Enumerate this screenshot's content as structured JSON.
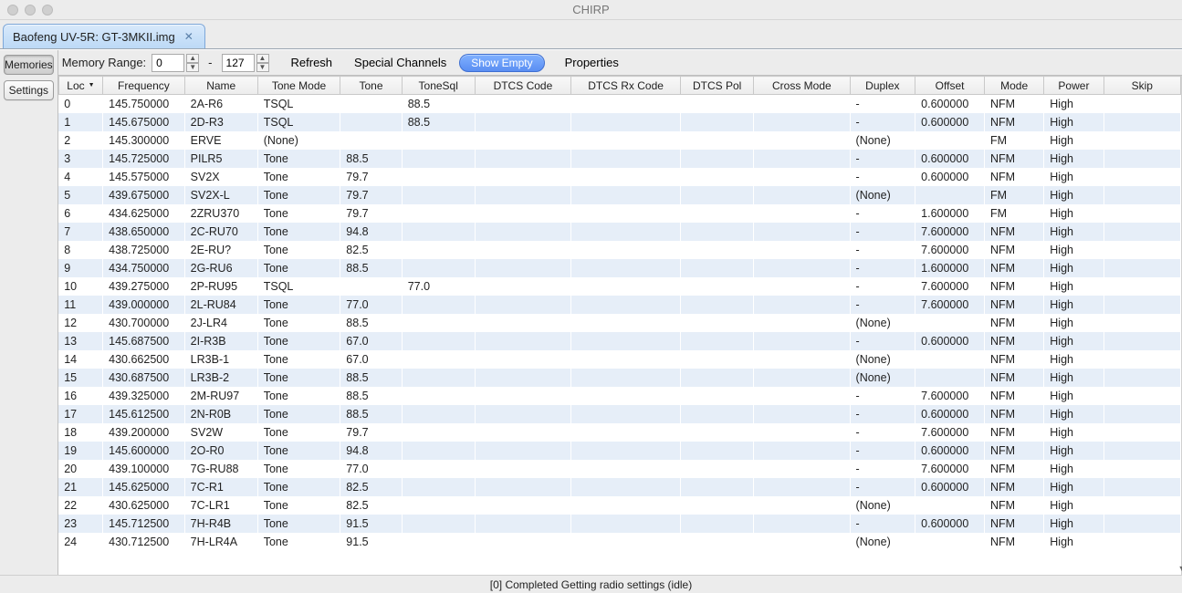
{
  "app_title": "CHIRP",
  "tab": {
    "label": "Baofeng UV-5R: GT-3MKII.img"
  },
  "sidebar": {
    "memories": "Memories",
    "settings": "Settings"
  },
  "toolbar": {
    "range_label": "Memory Range:",
    "from": "0",
    "dash": "-",
    "to": "127",
    "refresh": "Refresh",
    "special": "Special Channels",
    "show_empty": "Show Empty",
    "properties": "Properties"
  },
  "columns": [
    "Loc",
    "Frequency",
    "Name",
    "Tone Mode",
    "Tone",
    "ToneSql",
    "DTCS Code",
    "DTCS Rx Code",
    "DTCS Pol",
    "Cross Mode",
    "Duplex",
    "Offset",
    "Mode",
    "Power",
    "Skip"
  ],
  "rows": [
    {
      "loc": "0",
      "freq": "145.750000",
      "name": "2A-R6",
      "tonemode": "TSQL",
      "tone": "",
      "tonesql": "88.5",
      "dtcs": "",
      "dtcsrx": "",
      "dtcspol": "",
      "cross": "",
      "duplex": "-",
      "offset": "0.600000",
      "mode": "NFM",
      "power": "High",
      "skip": ""
    },
    {
      "loc": "1",
      "freq": "145.675000",
      "name": "2D-R3",
      "tonemode": "TSQL",
      "tone": "",
      "tonesql": "88.5",
      "dtcs": "",
      "dtcsrx": "",
      "dtcspol": "",
      "cross": "",
      "duplex": "-",
      "offset": "0.600000",
      "mode": "NFM",
      "power": "High",
      "skip": ""
    },
    {
      "loc": "2",
      "freq": "145.300000",
      "name": "ERVE",
      "tonemode": "(None)",
      "tone": "",
      "tonesql": "",
      "dtcs": "",
      "dtcsrx": "",
      "dtcspol": "",
      "cross": "",
      "duplex": "(None)",
      "offset": "",
      "mode": "FM",
      "power": "High",
      "skip": ""
    },
    {
      "loc": "3",
      "freq": "145.725000",
      "name": "PILR5",
      "tonemode": "Tone",
      "tone": "88.5",
      "tonesql": "",
      "dtcs": "",
      "dtcsrx": "",
      "dtcspol": "",
      "cross": "",
      "duplex": "-",
      "offset": "0.600000",
      "mode": "NFM",
      "power": "High",
      "skip": ""
    },
    {
      "loc": "4",
      "freq": "145.575000",
      "name": "SV2X",
      "tonemode": "Tone",
      "tone": "79.7",
      "tonesql": "",
      "dtcs": "",
      "dtcsrx": "",
      "dtcspol": "",
      "cross": "",
      "duplex": "-",
      "offset": "0.600000",
      "mode": "NFM",
      "power": "High",
      "skip": ""
    },
    {
      "loc": "5",
      "freq": "439.675000",
      "name": "SV2X-L",
      "tonemode": "Tone",
      "tone": "79.7",
      "tonesql": "",
      "dtcs": "",
      "dtcsrx": "",
      "dtcspol": "",
      "cross": "",
      "duplex": "(None)",
      "offset": "",
      "mode": "FM",
      "power": "High",
      "skip": ""
    },
    {
      "loc": "6",
      "freq": "434.625000",
      "name": "2ZRU370",
      "tonemode": "Tone",
      "tone": "79.7",
      "tonesql": "",
      "dtcs": "",
      "dtcsrx": "",
      "dtcspol": "",
      "cross": "",
      "duplex": "-",
      "offset": "1.600000",
      "mode": "FM",
      "power": "High",
      "skip": ""
    },
    {
      "loc": "7",
      "freq": "438.650000",
      "name": "2C-RU70",
      "tonemode": "Tone",
      "tone": "94.8",
      "tonesql": "",
      "dtcs": "",
      "dtcsrx": "",
      "dtcspol": "",
      "cross": "",
      "duplex": "-",
      "offset": "7.600000",
      "mode": "NFM",
      "power": "High",
      "skip": ""
    },
    {
      "loc": "8",
      "freq": "438.725000",
      "name": "2E-RU?",
      "tonemode": "Tone",
      "tone": "82.5",
      "tonesql": "",
      "dtcs": "",
      "dtcsrx": "",
      "dtcspol": "",
      "cross": "",
      "duplex": "-",
      "offset": "7.600000",
      "mode": "NFM",
      "power": "High",
      "skip": ""
    },
    {
      "loc": "9",
      "freq": "434.750000",
      "name": "2G-RU6",
      "tonemode": "Tone",
      "tone": "88.5",
      "tonesql": "",
      "dtcs": "",
      "dtcsrx": "",
      "dtcspol": "",
      "cross": "",
      "duplex": "-",
      "offset": "1.600000",
      "mode": "NFM",
      "power": "High",
      "skip": ""
    },
    {
      "loc": "10",
      "freq": "439.275000",
      "name": "2P-RU95",
      "tonemode": "TSQL",
      "tone": "",
      "tonesql": "77.0",
      "dtcs": "",
      "dtcsrx": "",
      "dtcspol": "",
      "cross": "",
      "duplex": "-",
      "offset": "7.600000",
      "mode": "NFM",
      "power": "High",
      "skip": ""
    },
    {
      "loc": "11",
      "freq": "439.000000",
      "name": "2L-RU84",
      "tonemode": "Tone",
      "tone": "77.0",
      "tonesql": "",
      "dtcs": "",
      "dtcsrx": "",
      "dtcspol": "",
      "cross": "",
      "duplex": "-",
      "offset": "7.600000",
      "mode": "NFM",
      "power": "High",
      "skip": ""
    },
    {
      "loc": "12",
      "freq": "430.700000",
      "name": "2J-LR4",
      "tonemode": "Tone",
      "tone": "88.5",
      "tonesql": "",
      "dtcs": "",
      "dtcsrx": "",
      "dtcspol": "",
      "cross": "",
      "duplex": "(None)",
      "offset": "",
      "mode": "NFM",
      "power": "High",
      "skip": ""
    },
    {
      "loc": "13",
      "freq": "145.687500",
      "name": "2I-R3B",
      "tonemode": "Tone",
      "tone": "67.0",
      "tonesql": "",
      "dtcs": "",
      "dtcsrx": "",
      "dtcspol": "",
      "cross": "",
      "duplex": "-",
      "offset": "0.600000",
      "mode": "NFM",
      "power": "High",
      "skip": ""
    },
    {
      "loc": "14",
      "freq": "430.662500",
      "name": "LR3B-1",
      "tonemode": "Tone",
      "tone": "67.0",
      "tonesql": "",
      "dtcs": "",
      "dtcsrx": "",
      "dtcspol": "",
      "cross": "",
      "duplex": "(None)",
      "offset": "",
      "mode": "NFM",
      "power": "High",
      "skip": ""
    },
    {
      "loc": "15",
      "freq": "430.687500",
      "name": "LR3B-2",
      "tonemode": "Tone",
      "tone": "88.5",
      "tonesql": "",
      "dtcs": "",
      "dtcsrx": "",
      "dtcspol": "",
      "cross": "",
      "duplex": "(None)",
      "offset": "",
      "mode": "NFM",
      "power": "High",
      "skip": ""
    },
    {
      "loc": "16",
      "freq": "439.325000",
      "name": "2M-RU97",
      "tonemode": "Tone",
      "tone": "88.5",
      "tonesql": "",
      "dtcs": "",
      "dtcsrx": "",
      "dtcspol": "",
      "cross": "",
      "duplex": "-",
      "offset": "7.600000",
      "mode": "NFM",
      "power": "High",
      "skip": ""
    },
    {
      "loc": "17",
      "freq": "145.612500",
      "name": "2N-R0B",
      "tonemode": "Tone",
      "tone": "88.5",
      "tonesql": "",
      "dtcs": "",
      "dtcsrx": "",
      "dtcspol": "",
      "cross": "",
      "duplex": "-",
      "offset": "0.600000",
      "mode": "NFM",
      "power": "High",
      "skip": ""
    },
    {
      "loc": "18",
      "freq": "439.200000",
      "name": "SV2W",
      "tonemode": "Tone",
      "tone": "79.7",
      "tonesql": "",
      "dtcs": "",
      "dtcsrx": "",
      "dtcspol": "",
      "cross": "",
      "duplex": "-",
      "offset": "7.600000",
      "mode": "NFM",
      "power": "High",
      "skip": ""
    },
    {
      "loc": "19",
      "freq": "145.600000",
      "name": "2O-R0",
      "tonemode": "Tone",
      "tone": "94.8",
      "tonesql": "",
      "dtcs": "",
      "dtcsrx": "",
      "dtcspol": "",
      "cross": "",
      "duplex": "-",
      "offset": "0.600000",
      "mode": "NFM",
      "power": "High",
      "skip": ""
    },
    {
      "loc": "20",
      "freq": "439.100000",
      "name": "7G-RU88",
      "tonemode": "Tone",
      "tone": "77.0",
      "tonesql": "",
      "dtcs": "",
      "dtcsrx": "",
      "dtcspol": "",
      "cross": "",
      "duplex": "-",
      "offset": "7.600000",
      "mode": "NFM",
      "power": "High",
      "skip": ""
    },
    {
      "loc": "21",
      "freq": "145.625000",
      "name": "7C-R1",
      "tonemode": "Tone",
      "tone": "82.5",
      "tonesql": "",
      "dtcs": "",
      "dtcsrx": "",
      "dtcspol": "",
      "cross": "",
      "duplex": "-",
      "offset": "0.600000",
      "mode": "NFM",
      "power": "High",
      "skip": ""
    },
    {
      "loc": "22",
      "freq": "430.625000",
      "name": "7C-LR1",
      "tonemode": "Tone",
      "tone": "82.5",
      "tonesql": "",
      "dtcs": "",
      "dtcsrx": "",
      "dtcspol": "",
      "cross": "",
      "duplex": "(None)",
      "offset": "",
      "mode": "NFM",
      "power": "High",
      "skip": ""
    },
    {
      "loc": "23",
      "freq": "145.712500",
      "name": "7H-R4B",
      "tonemode": "Tone",
      "tone": "91.5",
      "tonesql": "",
      "dtcs": "",
      "dtcsrx": "",
      "dtcspol": "",
      "cross": "",
      "duplex": "-",
      "offset": "0.600000",
      "mode": "NFM",
      "power": "High",
      "skip": ""
    },
    {
      "loc": "24",
      "freq": "430.712500",
      "name": "7H-LR4A",
      "tonemode": "Tone",
      "tone": "91.5",
      "tonesql": "",
      "dtcs": "",
      "dtcsrx": "",
      "dtcspol": "",
      "cross": "",
      "duplex": "(None)",
      "offset": "",
      "mode": "NFM",
      "power": "High",
      "skip": ""
    }
  ],
  "status": "[0] Completed Getting radio settings (idle)"
}
